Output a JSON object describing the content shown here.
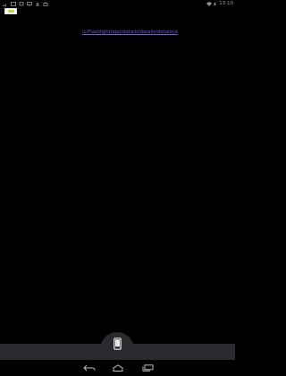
{
  "status_bar": {
    "time": "13:10",
    "left_icons": [
      "signal-icon",
      "image-icon",
      "usb-icon",
      "monitor-icon",
      "download-icon",
      "bag-icon"
    ],
    "right_icons": [
      "wifi-icon",
      "battery-icon"
    ]
  },
  "content": {
    "link_text": "lc/Flashlight/app/details/details/details/e"
  },
  "dock": {
    "center_icon": "phone-icon"
  },
  "nav": {
    "back_icon": "back-icon",
    "home_icon": "home-icon",
    "recents_icon": "recents-icon"
  },
  "colors": {
    "background": "#000000",
    "link": "#6b5fd6",
    "dock": "#2a2a2e",
    "status_icons": "#9a9a9a"
  }
}
